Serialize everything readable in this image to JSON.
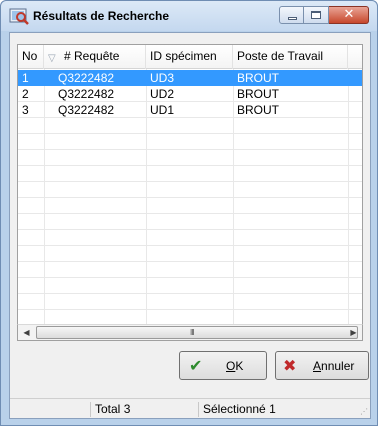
{
  "window": {
    "title": "Résultats de Recherche",
    "close_glyph": "✕",
    "accent": "#3399ff"
  },
  "grid": {
    "columns": [
      "No",
      "# Requête",
      "ID spécimen",
      "Poste de Travail"
    ],
    "rows": [
      [
        "1",
        "Q3222482",
        "UD3",
        "BROUT"
      ],
      [
        "2",
        "Q3222482",
        "UD2",
        "BROUT"
      ],
      [
        "3",
        "Q3222482",
        "UD1",
        "BROUT"
      ]
    ],
    "selected_row": 0
  },
  "scrollbar": {
    "left_arrow": "◀",
    "right_arrow": "▶",
    "grip": "III"
  },
  "buttons": {
    "ok": {
      "label_pre": "",
      "label_ul": "O",
      "label_post": "K",
      "icon": "check-icon"
    },
    "cancel": {
      "label_pre": "",
      "label_ul": "A",
      "label_post": "nnuler",
      "icon": "x-icon"
    }
  },
  "status": {
    "total_label": "Total",
    "total_value": "3",
    "selected_label": "Sélectionné",
    "selected_value": "1"
  }
}
